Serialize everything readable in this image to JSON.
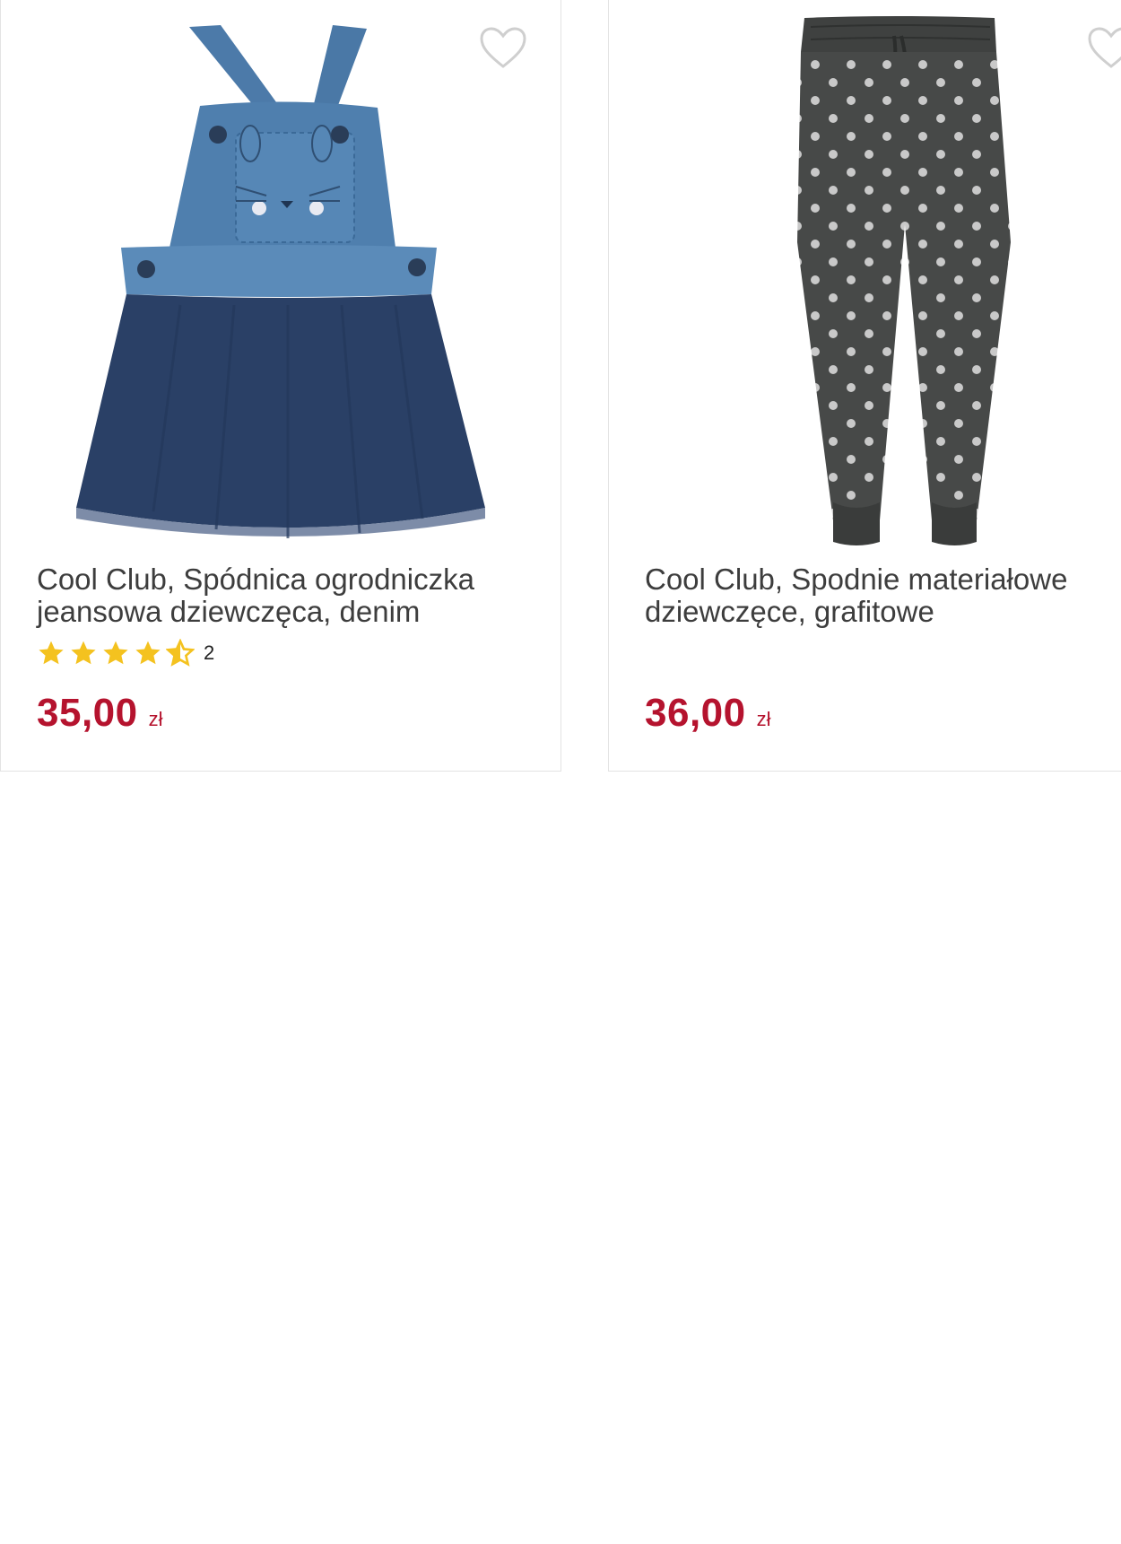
{
  "products": [
    {
      "name": "Cool Club, Spódnica ogrodniczka jeansowa dziewczęca, denim",
      "rating_value": 4.5,
      "rating_count": "2",
      "price": "35,00",
      "currency": "zł",
      "favorite_icon": "heart-outline-icon",
      "image": "denim-pinafore-skirt-image"
    },
    {
      "name": "Cool Club, Spodnie materiałowe dziewczęce, grafitowe",
      "price": "36,00",
      "currency": "zł",
      "favorite_icon": "heart-outline-icon",
      "image": "polka-dot-trousers-image"
    }
  ],
  "colors": {
    "price": "#b5132e",
    "star": "#f4c21f",
    "title": "#3d3d3d",
    "border": "#e3e3e3"
  }
}
